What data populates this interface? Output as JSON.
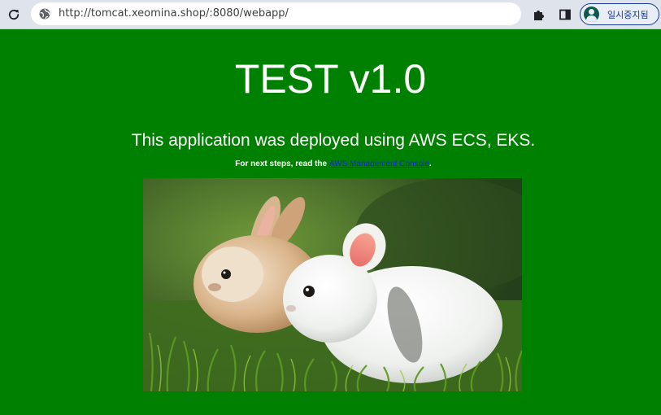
{
  "browser": {
    "url": "http://tomcat.xeomina.shop/:8080/webapp/",
    "profile_label": "일시중지됨"
  },
  "page": {
    "title": "TEST v1.0",
    "subtitle": "This application was deployed using AWS ECS, EKS.",
    "next_steps_prefix": "For next steps, read the ",
    "next_steps_link": "AWS Management Console",
    "next_steps_suffix": "."
  },
  "colors": {
    "page_background": "#008000",
    "text": "#ffffff",
    "link": "#1a1aff"
  },
  "icons": {
    "reload": "reload-icon",
    "site_info": "site-info-icon",
    "extensions": "puzzle-icon",
    "side_panel": "side-panel-icon",
    "profile": "avatar"
  }
}
